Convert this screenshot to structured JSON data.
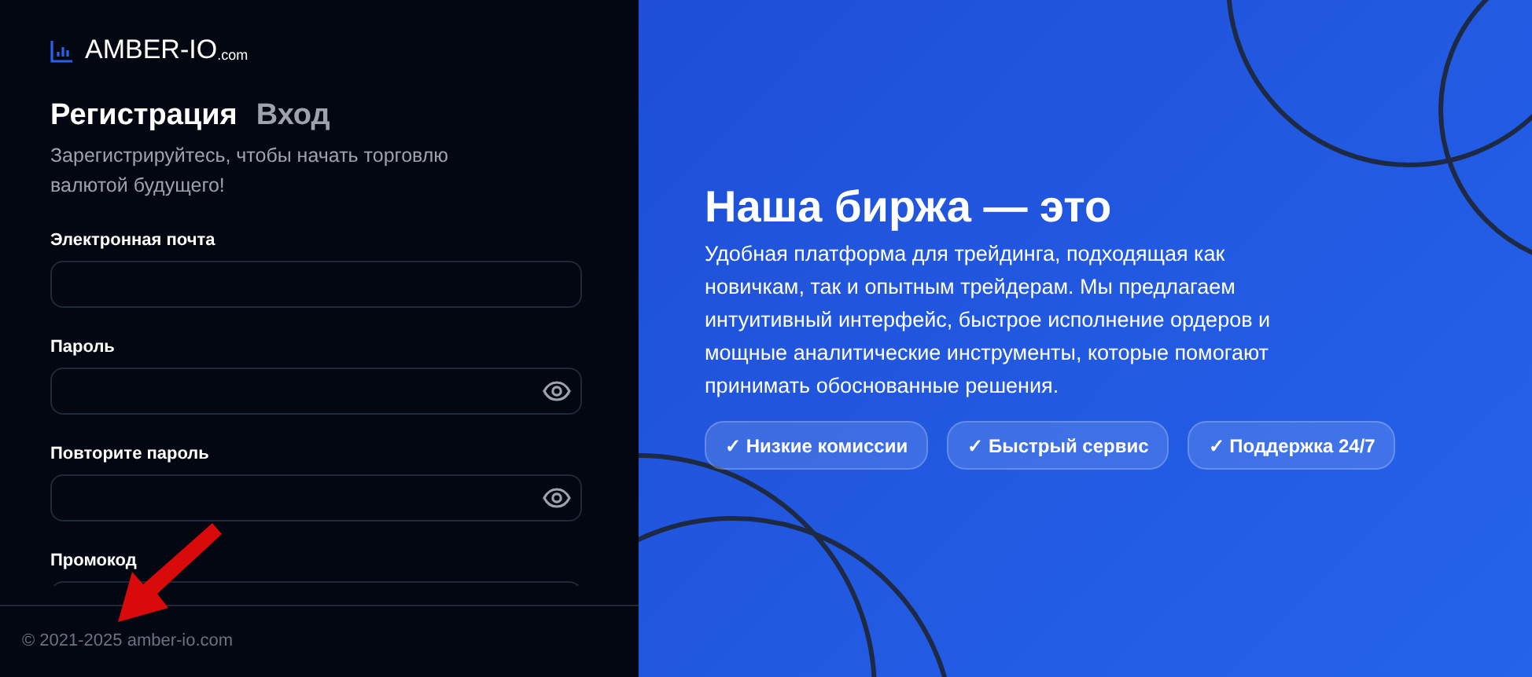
{
  "logo": {
    "name": "AMBER-IO",
    "suffix": ".com"
  },
  "tabs": [
    {
      "label": "Регистрация",
      "selected": true
    },
    {
      "label": "Вход",
      "selected": false
    }
  ],
  "subtitle": "Зарегистрируйтесь, чтобы начать торговлю валютой будущего!",
  "fields": [
    {
      "label": "Электронная почта",
      "kind": "text"
    },
    {
      "label": "Пароль",
      "kind": "password"
    },
    {
      "label": "Повторите пароль",
      "kind": "password"
    },
    {
      "label": "Промокод",
      "kind": "text"
    }
  ],
  "footer": "© 2021-2025 amber-io.com",
  "promo": {
    "title": "Наша биржа — это",
    "text": "Удобная платформа для трейдинга, подходящая как новичкам, так и опытным трейдерам. Мы предлагаем интуитивный интерфейс, быстрое исполнение ордеров и мощные аналитические инструменты, которые помогают принимать обоснованные решения.",
    "badges": [
      "✓ Низкие комиссии",
      "✓ Быстрый сервис",
      "✓ Поддержка 24/7"
    ]
  }
}
